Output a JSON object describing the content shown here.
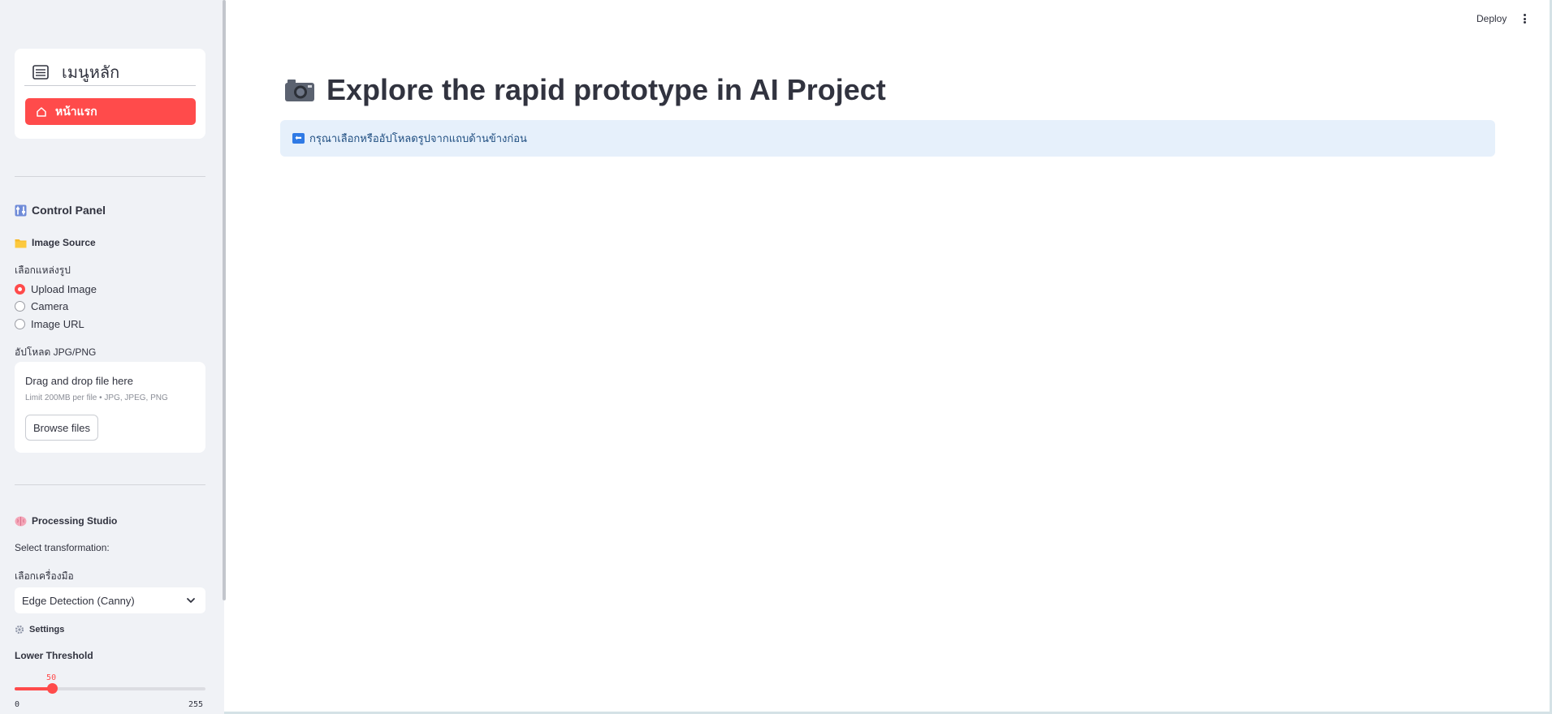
{
  "header": {
    "deploy_label": "Deploy"
  },
  "sidebar": {
    "nav": {
      "title": "เมนูหลัก",
      "home_label": "หน้าแรก",
      "accent": "#ff4b4b"
    },
    "control_panel": {
      "title": "Control Panel",
      "icon": "control-knobs-icon"
    },
    "image_source": {
      "title": "Image Source",
      "icon": "folder-icon",
      "radio_label": "เลือกแหล่งรูป",
      "options": [
        {
          "label": "Upload Image",
          "selected": true
        },
        {
          "label": "Camera",
          "selected": false
        },
        {
          "label": "Image URL",
          "selected": false
        }
      ],
      "uploader_label": "อัปโหลด JPG/PNG",
      "drag_text": "Drag and drop file here",
      "limit_text": "Limit 200MB per file • JPG, JPEG, PNG",
      "browse_label": "Browse files"
    },
    "processing": {
      "title": "Processing Studio",
      "icon": "brain-icon",
      "subtitle": "Select transformation:",
      "tool_label": "เลือกเครื่องมือ",
      "tool_value": "Edge Detection (Canny)",
      "settings_title": "Settings",
      "settings_icon": "gear-icon",
      "slider_label": "Lower Threshold",
      "slider_value": "50",
      "slider_min": "0",
      "slider_max": "255",
      "slider_fraction": 0.196
    }
  },
  "main": {
    "title": "Explore the rapid prototype in AI Project",
    "title_icon": "camera-icon",
    "info_text": "กรุณาเลือกหรืออัปโหลดรูปจากแถบด้านข้างก่อน",
    "info_icon": "left-arrow-icon"
  }
}
